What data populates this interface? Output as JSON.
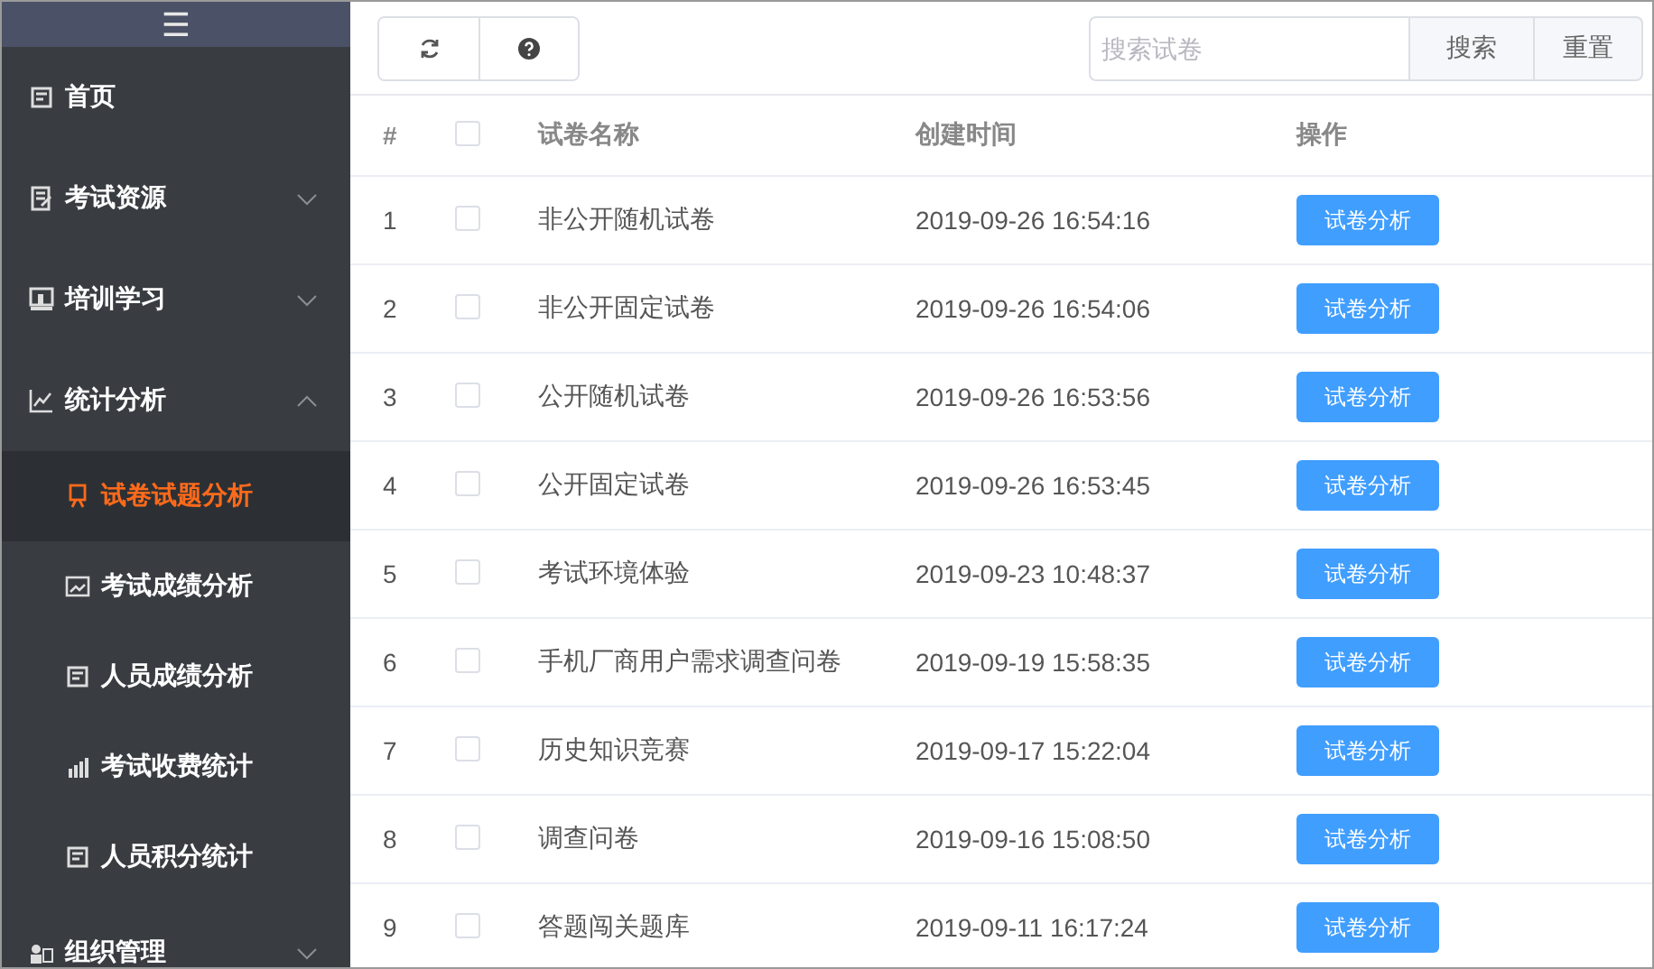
{
  "sidebar": {
    "menu_icon": "☰",
    "items": [
      {
        "label": "首页",
        "kind": "link",
        "selected": false
      },
      {
        "label": "考试资源",
        "kind": "group",
        "expanded": false,
        "selected": false
      },
      {
        "label": "培训学习",
        "kind": "group",
        "expanded": false,
        "selected": false
      },
      {
        "label": "统计分析",
        "kind": "group",
        "expanded": true,
        "selected": false,
        "children": [
          {
            "label": "试卷试题分析",
            "selected": true
          },
          {
            "label": "考试成绩分析",
            "selected": false
          },
          {
            "label": "人员成绩分析",
            "selected": false
          },
          {
            "label": "考试收费统计",
            "selected": false
          },
          {
            "label": "人员积分统计",
            "selected": false
          }
        ]
      },
      {
        "label": "组织管理",
        "kind": "group",
        "expanded": false,
        "selected": false
      }
    ]
  },
  "toolbar": {
    "search": {
      "placeholder": "搜索试卷"
    },
    "buttons": [
      "搜索",
      "重置"
    ]
  },
  "table": {
    "columns": [
      "#",
      "试卷名称",
      "创建时间",
      "操作"
    ],
    "header_checked": false,
    "rows": [
      {
        "index": "1",
        "checked": false,
        "name": "非公开随机试卷",
        "created": "2019-09-26 16:54:16",
        "action": "试卷分析"
      },
      {
        "index": "2",
        "checked": false,
        "name": "非公开固定试卷",
        "created": "2019-09-26 16:54:06",
        "action": "试卷分析"
      },
      {
        "index": "3",
        "checked": false,
        "name": "公开随机试卷",
        "created": "2019-09-26 16:53:56",
        "action": "试卷分析"
      },
      {
        "index": "4",
        "checked": false,
        "name": "公开固定试卷",
        "created": "2019-09-26 16:53:45",
        "action": "试卷分析"
      },
      {
        "index": "5",
        "checked": false,
        "name": "考试环境体验",
        "created": "2019-09-23 10:48:37",
        "action": "试卷分析"
      },
      {
        "index": "6",
        "checked": false,
        "name": "手机厂商用户需求调查问卷",
        "created": "2019-09-19 15:58:35",
        "action": "试卷分析"
      },
      {
        "index": "7",
        "checked": false,
        "name": "历史知识竞赛",
        "created": "2019-09-17 15:22:04",
        "action": "试卷分析"
      },
      {
        "index": "8",
        "checked": false,
        "name": "调查问卷",
        "created": "2019-09-16 15:08:50",
        "action": "试卷分析"
      },
      {
        "index": "9",
        "checked": false,
        "name": "答题闯关题库",
        "created": "2019-09-11 16:17:24",
        "action": "试卷分析"
      }
    ]
  }
}
